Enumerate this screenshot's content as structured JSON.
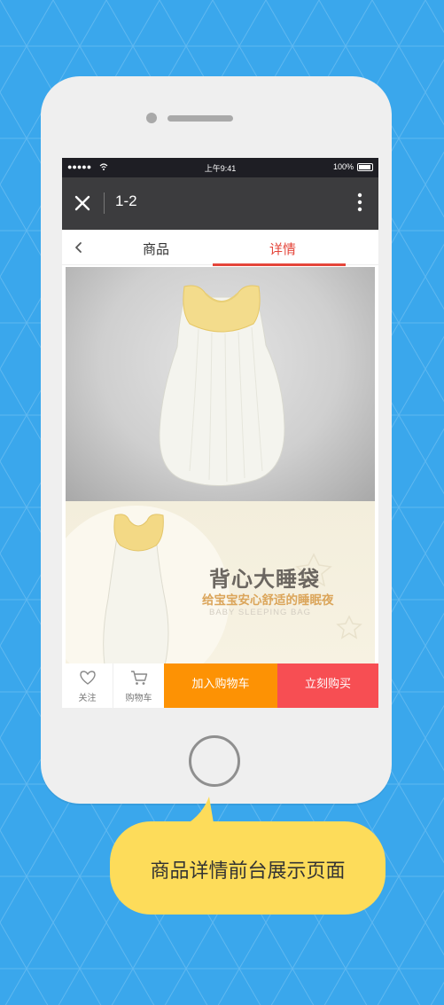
{
  "status_bar": {
    "signal": "●●●●●",
    "time": "上午9:41",
    "battery": "100%"
  },
  "nav": {
    "title": "1-2"
  },
  "tabs": [
    {
      "label": "商品",
      "active": false
    },
    {
      "label": "详情",
      "active": true
    }
  ],
  "product_banner": {
    "title": "背心大睡袋",
    "subtitle": "给宝宝安心舒适的睡眠夜",
    "english": "BABY SLEEPING BAG"
  },
  "actions": {
    "follow_label": "关注",
    "cart_label": "购物车",
    "add_to_cart_label": "加入购物车",
    "buy_now_label": "立刻购买"
  },
  "caption": "商品详情前台展示页面",
  "colors": {
    "background": "#3aa7ec",
    "accent_red": "#e4453a",
    "add_to_cart": "#fd9204",
    "buy_now": "#f74e53",
    "bubble": "#fddc5a"
  }
}
